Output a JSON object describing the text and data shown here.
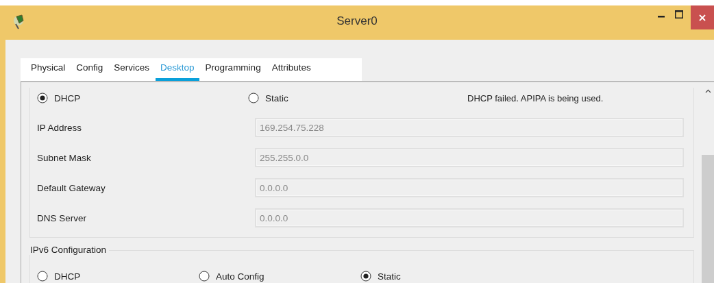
{
  "window": {
    "title": "Server0"
  },
  "tabs": [
    {
      "label": "Physical",
      "selected": false
    },
    {
      "label": "Config",
      "selected": false
    },
    {
      "label": "Services",
      "selected": false
    },
    {
      "label": "Desktop",
      "selected": true
    },
    {
      "label": "Programming",
      "selected": false
    },
    {
      "label": "Attributes",
      "selected": false
    }
  ],
  "ipv4": {
    "modes": [
      {
        "label": "DHCP",
        "selected": true
      },
      {
        "label": "Static",
        "selected": false
      }
    ],
    "status": "DHCP failed. APIPA is being used.",
    "fields": [
      {
        "label": "IP Address",
        "value": "169.254.75.228",
        "disabled": true
      },
      {
        "label": "Subnet Mask",
        "value": "255.255.0.0",
        "disabled": true
      },
      {
        "label": "Default Gateway",
        "value": "0.0.0.0",
        "disabled": true
      },
      {
        "label": "DNS Server",
        "value": "0.0.0.0",
        "disabled": true
      }
    ]
  },
  "ipv6": {
    "title": "IPv6 Configuration",
    "modes": [
      {
        "label": "DHCP",
        "selected": false
      },
      {
        "label": "Auto Config",
        "selected": false
      },
      {
        "label": "Static",
        "selected": true
      }
    ]
  }
}
